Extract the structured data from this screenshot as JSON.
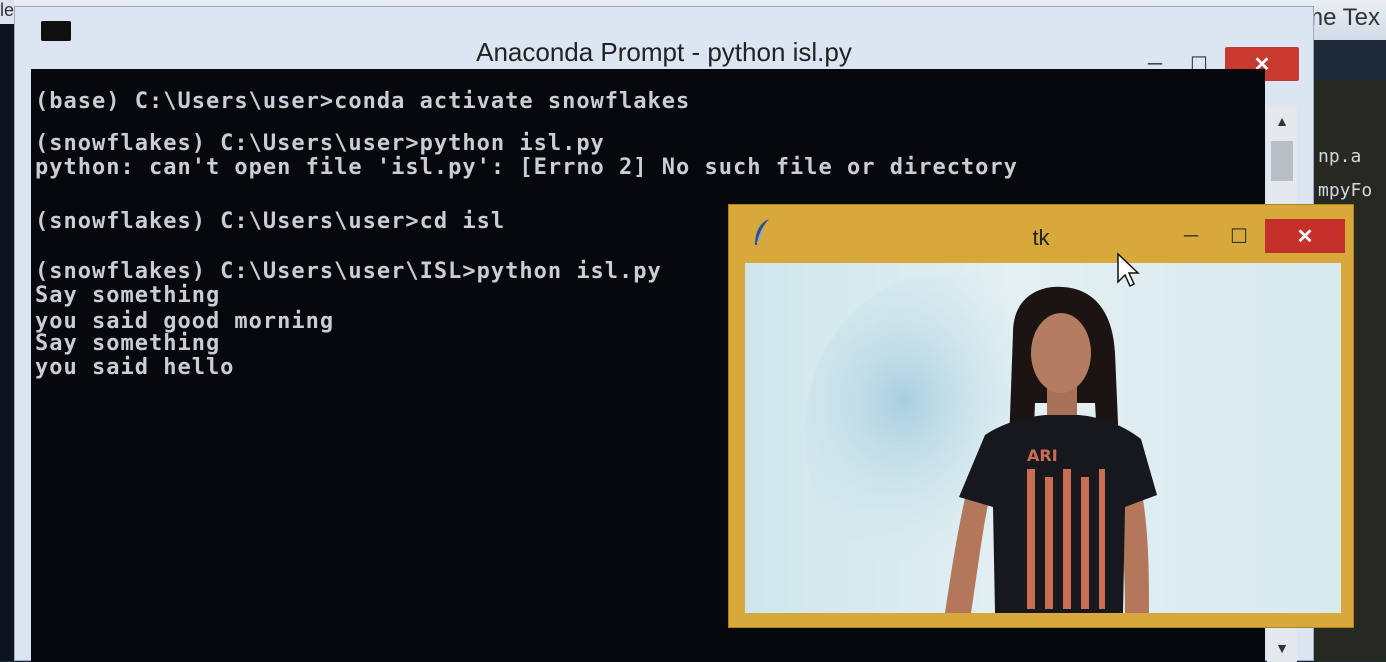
{
  "sublime": {
    "title": "C:\\Users\\user\\ISL\\isl.py - Sublime Tex",
    "edge_text": "le",
    "code_lines": [
      "np.a",
      "mpyFo"
    ]
  },
  "console": {
    "title": "Anaconda Prompt - python  isl.py",
    "min": "─",
    "max": "☐",
    "close": "✕",
    "lines": [
      "(base) C:\\Users\\user>conda activate snowflakes",
      "(snowflakes) C:\\Users\\user>python isl.py",
      "python: can't open file 'isl.py': [Errno 2] No such file or directory",
      "(snowflakes) C:\\Users\\user>cd isl",
      "(snowflakes) C:\\Users\\user\\ISL>python isl.py",
      "Say something",
      "you said good morning",
      "Say something",
      "you said hello"
    ],
    "scroll_up": "▲",
    "scroll_down": "▼"
  },
  "tk": {
    "title": "tk",
    "min": "─",
    "max": "☐",
    "close": "✕",
    "icon": "feather-icon",
    "image": "webcam-feed-person"
  },
  "colors": {
    "terminal_bg": "#06080c",
    "terminal_fg": "#c9cdd6",
    "tk_frame": "#d7a93a",
    "close_red": "#c8392f"
  }
}
